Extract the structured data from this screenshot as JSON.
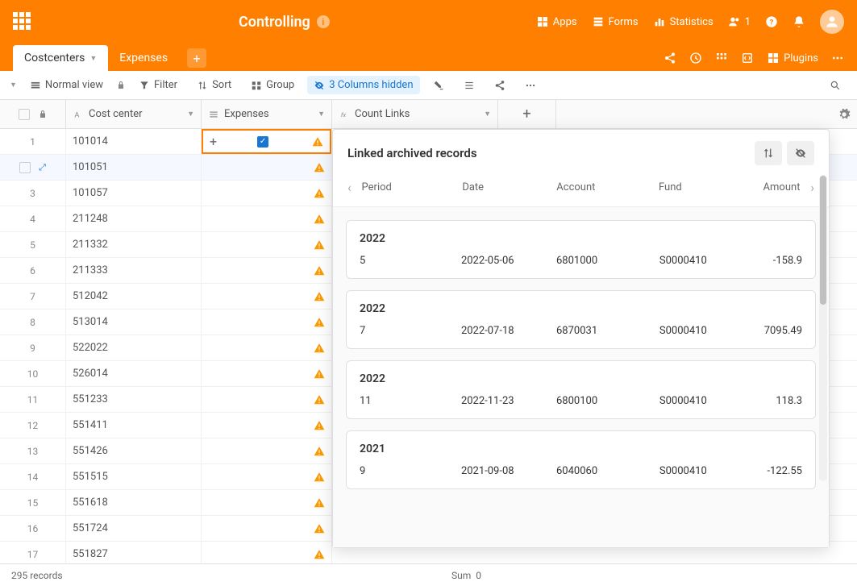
{
  "header": {
    "title": "Controlling",
    "apps": "Apps",
    "forms": "Forms",
    "statistics": "Statistics",
    "users": "1",
    "plugins": "Plugins"
  },
  "tabs": [
    {
      "label": "Costcenters",
      "active": true
    },
    {
      "label": "Expenses",
      "active": false
    }
  ],
  "toolbar": {
    "view": "Normal view",
    "filter": "Filter",
    "sort": "Sort",
    "group": "Group",
    "hidden": "3 Columns hidden"
  },
  "columns": {
    "cc": "Cost center",
    "exp": "Expenses",
    "cl": "Count Links"
  },
  "rows": [
    {
      "n": "1",
      "cc": "101014",
      "active": true
    },
    {
      "n": "",
      "cc": "101051",
      "sel": true
    },
    {
      "n": "3",
      "cc": "101057"
    },
    {
      "n": "4",
      "cc": "211248"
    },
    {
      "n": "5",
      "cc": "211332"
    },
    {
      "n": "6",
      "cc": "211333"
    },
    {
      "n": "7",
      "cc": "512042"
    },
    {
      "n": "8",
      "cc": "513014"
    },
    {
      "n": "9",
      "cc": "522022"
    },
    {
      "n": "10",
      "cc": "526014"
    },
    {
      "n": "11",
      "cc": "551233"
    },
    {
      "n": "12",
      "cc": "551411"
    },
    {
      "n": "13",
      "cc": "551426"
    },
    {
      "n": "14",
      "cc": "551515"
    },
    {
      "n": "15",
      "cc": "551618"
    },
    {
      "n": "16",
      "cc": "551724"
    },
    {
      "n": "17",
      "cc": "551827"
    }
  ],
  "panel": {
    "title": "Linked archived records",
    "cols": {
      "period": "Period",
      "date": "Date",
      "account": "Account",
      "fund": "Fund",
      "amount": "Amount"
    },
    "cards": [
      {
        "year": "2022",
        "period": "5",
        "date": "2022-05-06",
        "account": "6801000",
        "fund": "S0000410",
        "amount": "-158.9"
      },
      {
        "year": "2022",
        "period": "7",
        "date": "2022-07-18",
        "account": "6870031",
        "fund": "S0000410",
        "amount": "7095.49"
      },
      {
        "year": "2022",
        "period": "11",
        "date": "2022-11-23",
        "account": "6800100",
        "fund": "S0000410",
        "amount": "118.3"
      },
      {
        "year": "2021",
        "period": "9",
        "date": "2021-09-08",
        "account": "6040060",
        "fund": "S0000410",
        "amount": "-122.55"
      }
    ]
  },
  "footer": {
    "records": "295 records",
    "sum": "Sum",
    "sumval": "0"
  }
}
